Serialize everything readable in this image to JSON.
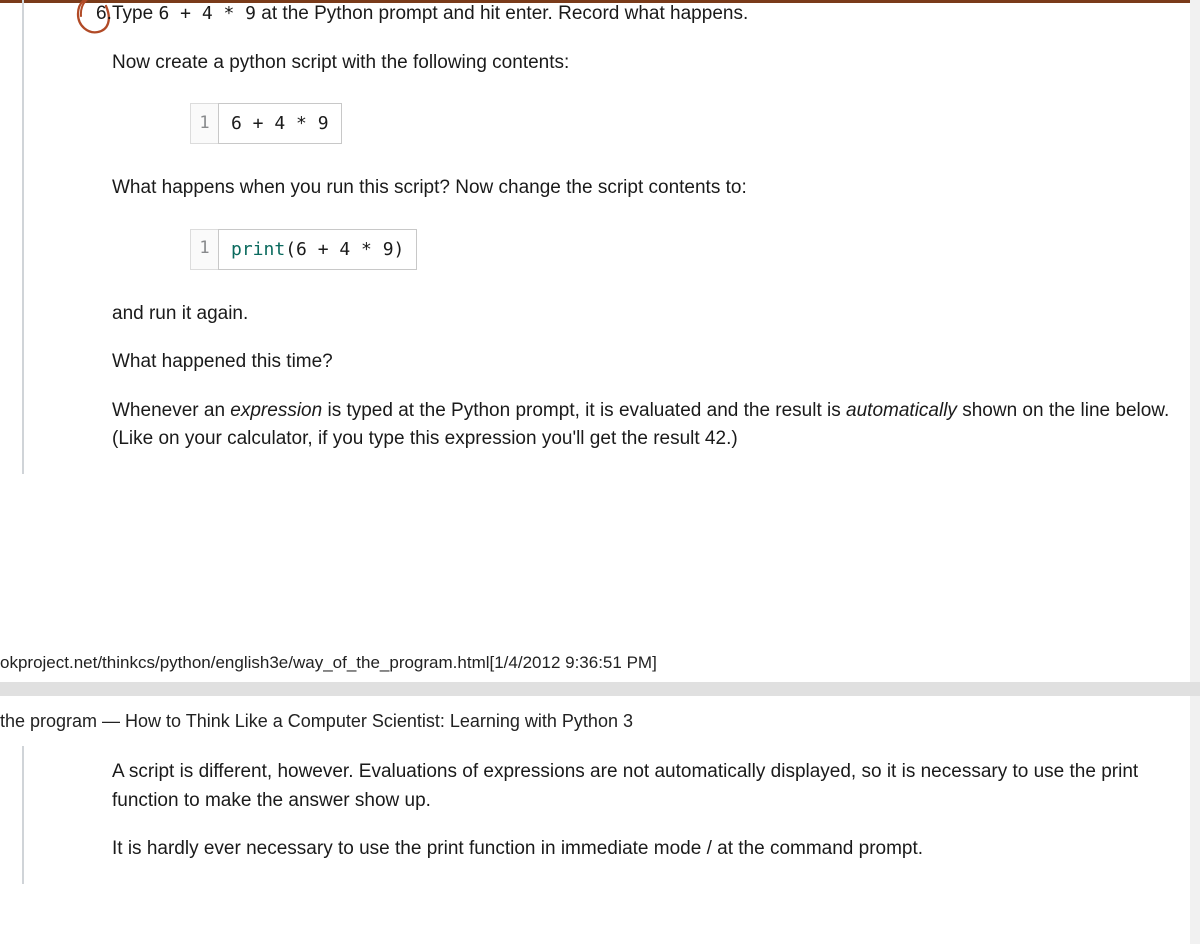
{
  "item_number": "6.",
  "para1_before": "Type ",
  "para1_code": "6 + 4 * 9",
  "para1_after": " at the Python prompt and hit enter. Record what happens.",
  "para2": "Now create a python script with the following contents:",
  "code1": {
    "lineno": "1",
    "text": "6 + 4 * 9"
  },
  "para3": "What happens when you run this script? Now change the script contents to:",
  "code2": {
    "lineno": "1",
    "fn": "print",
    "rest": "(6 + 4 * 9)"
  },
  "para4": "and run it again.",
  "para5": "What happened this time?",
  "para6_a": "Whenever an ",
  "para6_em1": "expression",
  "para6_b": " is typed at the Python prompt, it is evaluated and the result is ",
  "para6_em2": "automatically",
  "para6_c": " shown on the line below. (Like on your calculator, if you type this expression you'll get the result 42.)",
  "footer_url": "okproject.net/thinkcs/python/english3e/way_of_the_program.html[1/4/2012 9:36:51 PM]",
  "next_header": "the program — How to Think Like a Computer Scientist: Learning with Python 3",
  "para7": "A script is different, however. Evaluations of expressions are not automatically displayed, so it is necessary to use the print function to make the answer show up.",
  "para8": "It is hardly ever necessary to use the print function in immediate mode / at the command prompt."
}
